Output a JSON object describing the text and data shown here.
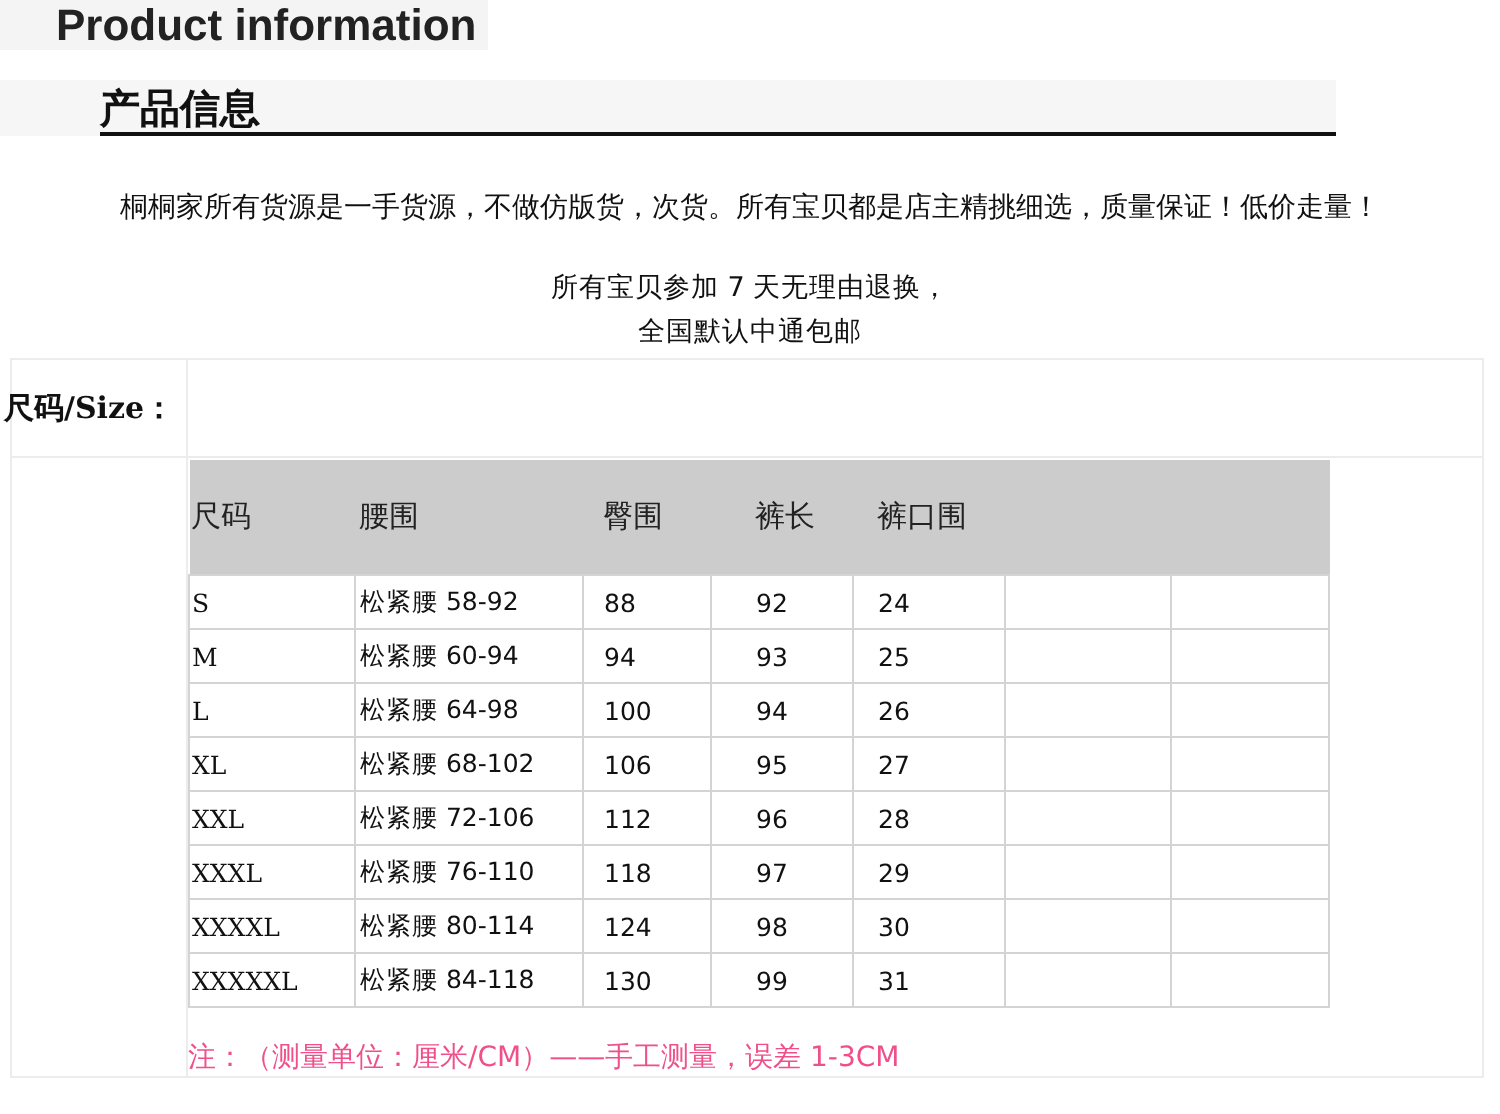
{
  "page_title": "Product information",
  "section_title": "产品信息",
  "intro": "桐桐家所有货源是一手货源，不做仿版货，次货。所有宝贝都是店主精挑细选，质量保证！低价走量！",
  "notice_lines": [
    "所有宝贝参加 7 天无理由退换，",
    "全国默认中通包邮"
  ],
  "size_label": "尺码/Size：",
  "size_table": {
    "columns": [
      "尺码",
      "腰围",
      "臀围",
      "裤长",
      "裤口围"
    ],
    "rows": [
      [
        "S",
        "松紧腰 58-92",
        "88",
        "92",
        "24"
      ],
      [
        "M",
        "松紧腰 60-94",
        "94",
        "93",
        "25"
      ],
      [
        "L",
        "松紧腰 64-98",
        "100",
        "94",
        "26"
      ],
      [
        "XL",
        "松紧腰 68-102",
        "106",
        "95",
        "27"
      ],
      [
        "XXL",
        "松紧腰 72-106",
        "112",
        "96",
        "28"
      ],
      [
        "XXXL",
        "松紧腰 76-110",
        "118",
        "97",
        "29"
      ],
      [
        "XXXXL",
        "松紧腰 80-114",
        "124",
        "98",
        "30"
      ],
      [
        "XXXXXL",
        "松紧腰 84-118",
        "130",
        "99",
        "31"
      ]
    ]
  },
  "note": "注：（测量单位：厘米/CM）——手工测量，误差 1-3CM"
}
